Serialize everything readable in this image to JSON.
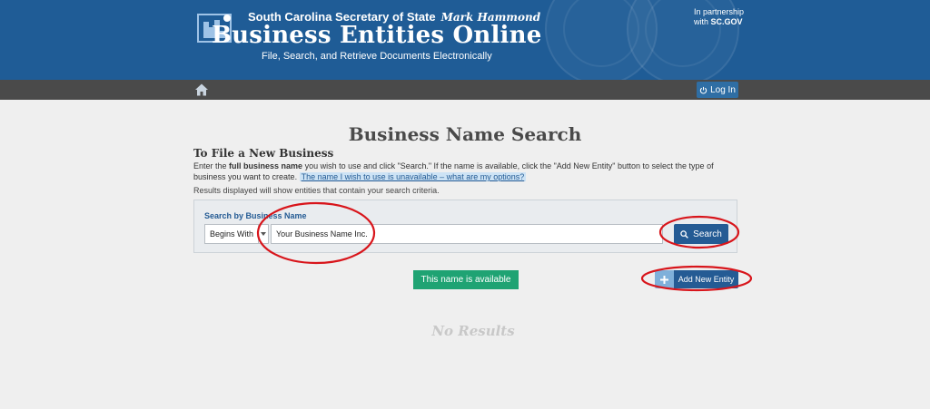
{
  "header": {
    "department": "South Carolina Secretary of State",
    "signature": "Mark Hammond",
    "app_title": "Business Entities Online",
    "tagline": "File, Search, and Retrieve Documents Electronically",
    "partner_line1": "In partnership",
    "partner_line2": "with",
    "partner_brand": "SC.GOV"
  },
  "nav": {
    "login_label": "Log In"
  },
  "main": {
    "page_title": "Business Name Search",
    "section_title": "To File a New Business",
    "instructions_pre": "Enter the ",
    "instructions_bold": "full business name",
    "instructions_post": " you wish to use and click \"Search.\" If the name is available, click the \"Add New Entity\" button to select the type of business you want to create.",
    "help_link": "The name I wish to use is unavailable – what are my options?",
    "note": "Results displayed will show entities that contain your search criteria."
  },
  "search": {
    "label": "Search by Business Name",
    "mode_selected": "Begins With",
    "input_value": "Your Business Name Inc.",
    "button_label": "Search"
  },
  "results": {
    "status": "This name is available",
    "add_label": "Add New Entity",
    "empty_text": "No Results"
  },
  "colors": {
    "header_bg": "#1f5c96",
    "primary": "#245b94",
    "success": "#1fa373",
    "annotation": "#d8151b"
  },
  "icons": [
    "home-icon",
    "power-icon",
    "search-icon",
    "plus-icon",
    "caret-down-icon",
    "logo-icon"
  ]
}
